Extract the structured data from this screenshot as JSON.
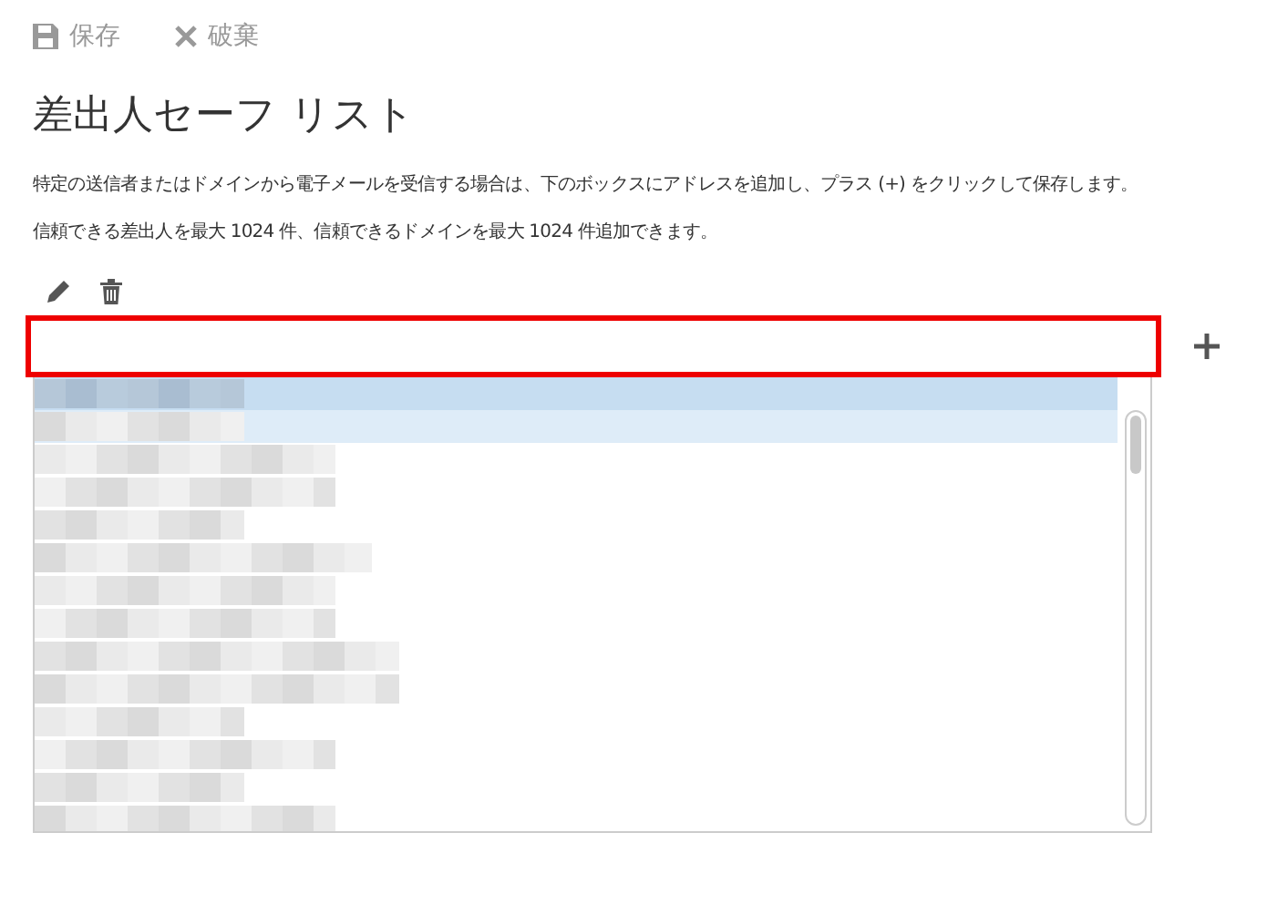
{
  "toolbar": [
    {
      "kind": "save",
      "label": "保存"
    },
    {
      "kind": "discard",
      "label": "破棄"
    }
  ],
  "title": "差出人セーフ リスト",
  "description": [
    "特定の送信者またはドメインから電子メールを受信する場合は、下のボックスにアドレスを追加し、プラス (+) をクリックして保存します。",
    "信頼できる差出人を最大 1024 件、信頼できるドメインを最大 1024 件追加できます。"
  ],
  "address_field": {
    "outlined": true
  },
  "entries": [
    {
      "kind": "picture",
      "selected": true,
      "hovered": false
    },
    {
      "kind": "picture",
      "selected": false,
      "hovered": true
    },
    {
      "kind": "picture",
      "selected": false,
      "hovered": false
    },
    {
      "kind": "picture",
      "selected": false,
      "hovered": false
    },
    {
      "kind": "picture",
      "selected": false,
      "hovered": false
    },
    {
      "kind": "picture",
      "selected": false,
      "hovered": false
    },
    {
      "kind": "picture",
      "selected": false,
      "hovered": false
    },
    {
      "kind": "picture",
      "selected": false,
      "hovered": false
    },
    {
      "kind": "picture",
      "selected": false,
      "hovered": false
    },
    {
      "kind": "picture",
      "selected": false,
      "hovered": false
    },
    {
      "kind": "picture",
      "selected": false,
      "hovered": false
    },
    {
      "kind": "picture",
      "selected": false,
      "hovered": false
    },
    {
      "kind": "picture",
      "selected": false,
      "hovered": false
    },
    {
      "kind": "picture",
      "selected": false,
      "hovered": false
    }
  ]
}
